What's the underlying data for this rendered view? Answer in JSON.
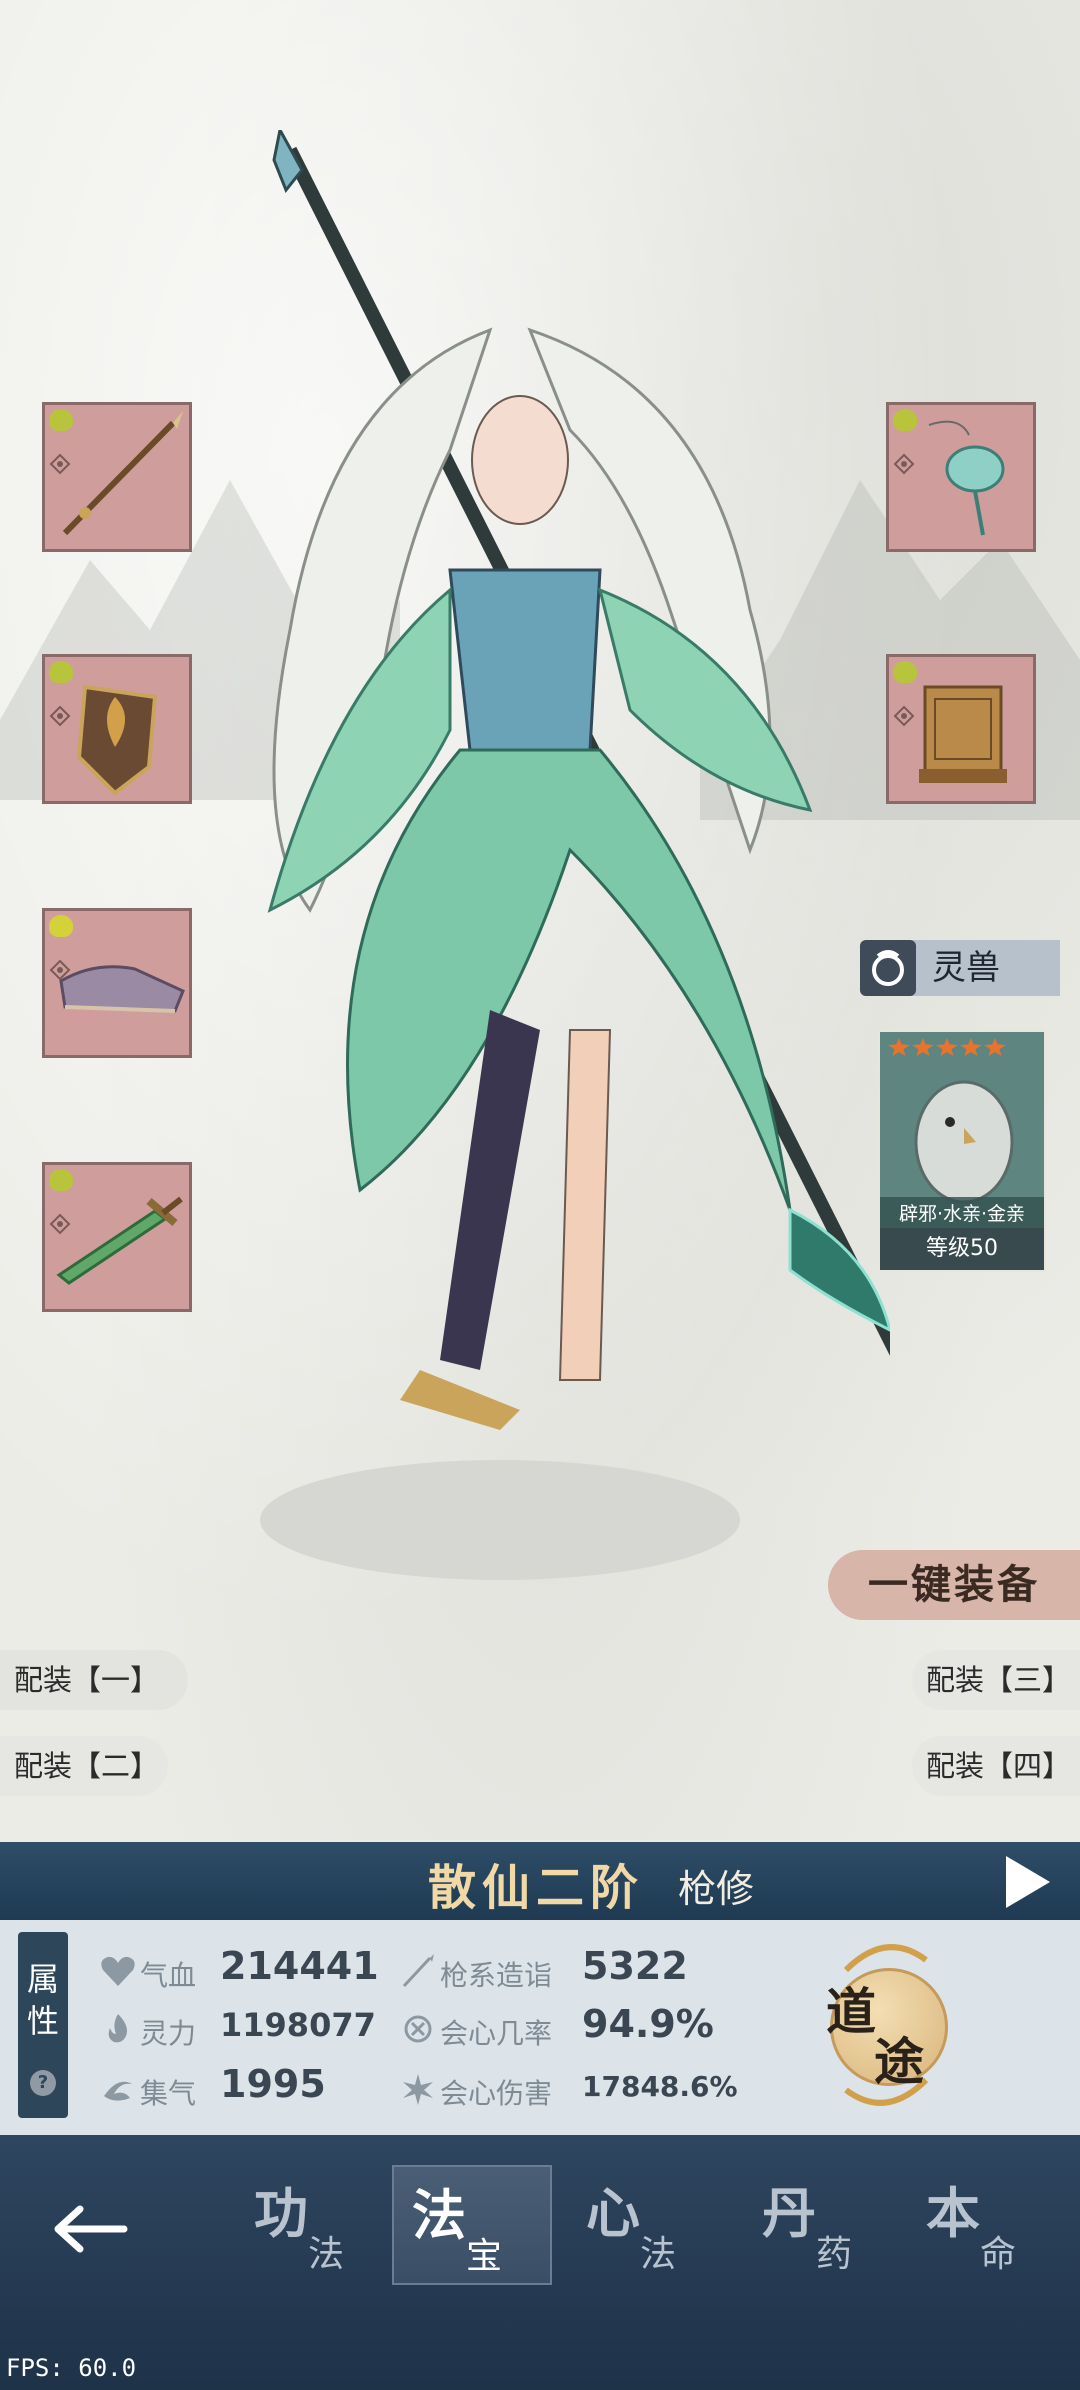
{
  "equipment_left": [
    {
      "item": "spear"
    },
    {
      "item": "shield"
    },
    {
      "item": "boots"
    },
    {
      "item": "sword"
    }
  ],
  "equipment_right": [
    {
      "item": "pendant"
    },
    {
      "item": "seal-box"
    }
  ],
  "spirit_beast": {
    "tab_label": "灵兽",
    "stars": 5,
    "name": "辟邪·水亲·金亲",
    "level": "等级50"
  },
  "one_key_equip": "一键装备",
  "loadouts": {
    "one": "配装【一】",
    "two": "配装【二】",
    "three": "配装【三】",
    "four": "配装【四】"
  },
  "rank": {
    "title": "散仙二阶",
    "class": "枪修"
  },
  "attributes": {
    "tab_line1": "属",
    "tab_line2": "性",
    "help": "?",
    "hp_label": "气血",
    "hp_value": "214441",
    "spirit_label": "灵力",
    "spirit_value": "1198077",
    "qi_label": "集气",
    "qi_value": "1995",
    "spear_label": "枪系造诣",
    "spear_value": "5322",
    "crit_rate_label": "会心几率",
    "crit_rate_value": "94.9%",
    "crit_dmg_label": "会心伤害",
    "crit_dmg_value": "17848.6%"
  },
  "dao_button": {
    "c1": "道",
    "c2": "途"
  },
  "nav": {
    "tabs": [
      {
        "big": "功",
        "small": "法"
      },
      {
        "big": "法",
        "small": "宝"
      },
      {
        "big": "心",
        "small": "法"
      },
      {
        "big": "丹",
        "small": "药"
      },
      {
        "big": "本",
        "small": "命"
      }
    ],
    "active": "法宝"
  },
  "fps": "FPS: 60.0",
  "colors": {
    "slot_bg": "#cf9e9c",
    "rank_bar": "#2e4d68",
    "nav_bg": "#2f4660",
    "rank_text": "#f0d9a6"
  }
}
